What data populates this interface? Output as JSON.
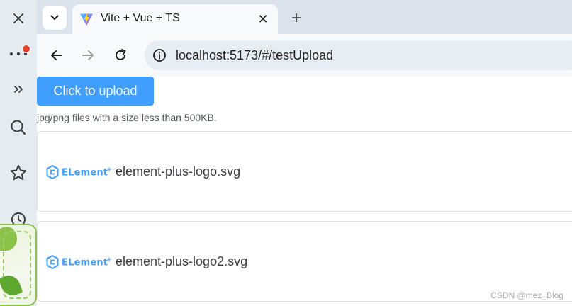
{
  "sidebar": {
    "close_icon": "close-icon",
    "more_icon": "more-dots-icon",
    "expand_icon": "double-chevron-right-icon",
    "search_icon": "search-icon",
    "favorites_icon": "star-icon",
    "history_icon": "clock-icon",
    "badge_color": "#e5422f"
  },
  "tabs": {
    "active_title": "Vite + Vue + TS",
    "close_label": "✕",
    "new_tab_label": "+"
  },
  "toolbar": {
    "url_host": "localhost",
    "url_path": ":5173/#/testUpload"
  },
  "page": {
    "upload_button_label": "Click to upload",
    "tip": "jpg/png files with a size less than 500KB.",
    "accent_color": "#409eff",
    "files": [
      {
        "logo_text": "ELement",
        "logo_plus": "+",
        "name": "element-plus-logo.svg"
      },
      {
        "logo_text": "ELement",
        "logo_plus": "+",
        "name": "element-plus-logo2.svg"
      }
    ]
  },
  "watermark": "CSDN @mez_Blog"
}
